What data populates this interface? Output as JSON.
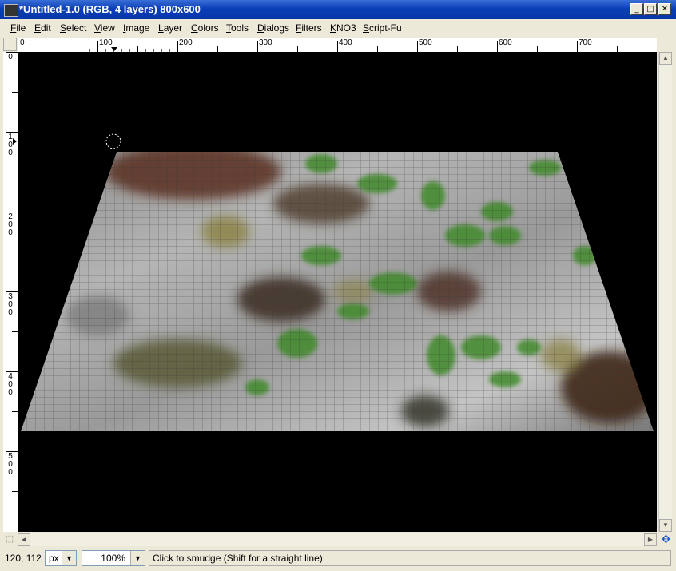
{
  "window": {
    "title": "*Untitled-1.0 (RGB, 4 layers) 800x600",
    "minimize_glyph": "_",
    "maximize_glyph": "□",
    "close_glyph": "✕"
  },
  "menubar": {
    "items": [
      "File",
      "Edit",
      "Select",
      "View",
      "Image",
      "Layer",
      "Colors",
      "Tools",
      "Dialogs",
      "Filters",
      "KNO3",
      "Script-Fu"
    ]
  },
  "rulers": {
    "horizontal_labels": [
      "0",
      "100",
      "200",
      "300",
      "400",
      "500",
      "600",
      "700"
    ],
    "vertical_labels": [
      "0",
      "100",
      "200",
      "300",
      "400",
      "500"
    ]
  },
  "statusbar": {
    "coords": "120, 112",
    "unit": "px",
    "zoom": "100%",
    "hint": "Click to smudge (Shift for a straight line)"
  },
  "icons": {
    "navigate": "navigate-icon",
    "quick_mask": "quick-mask-icon",
    "brush_outline": "brush-outline-icon"
  }
}
